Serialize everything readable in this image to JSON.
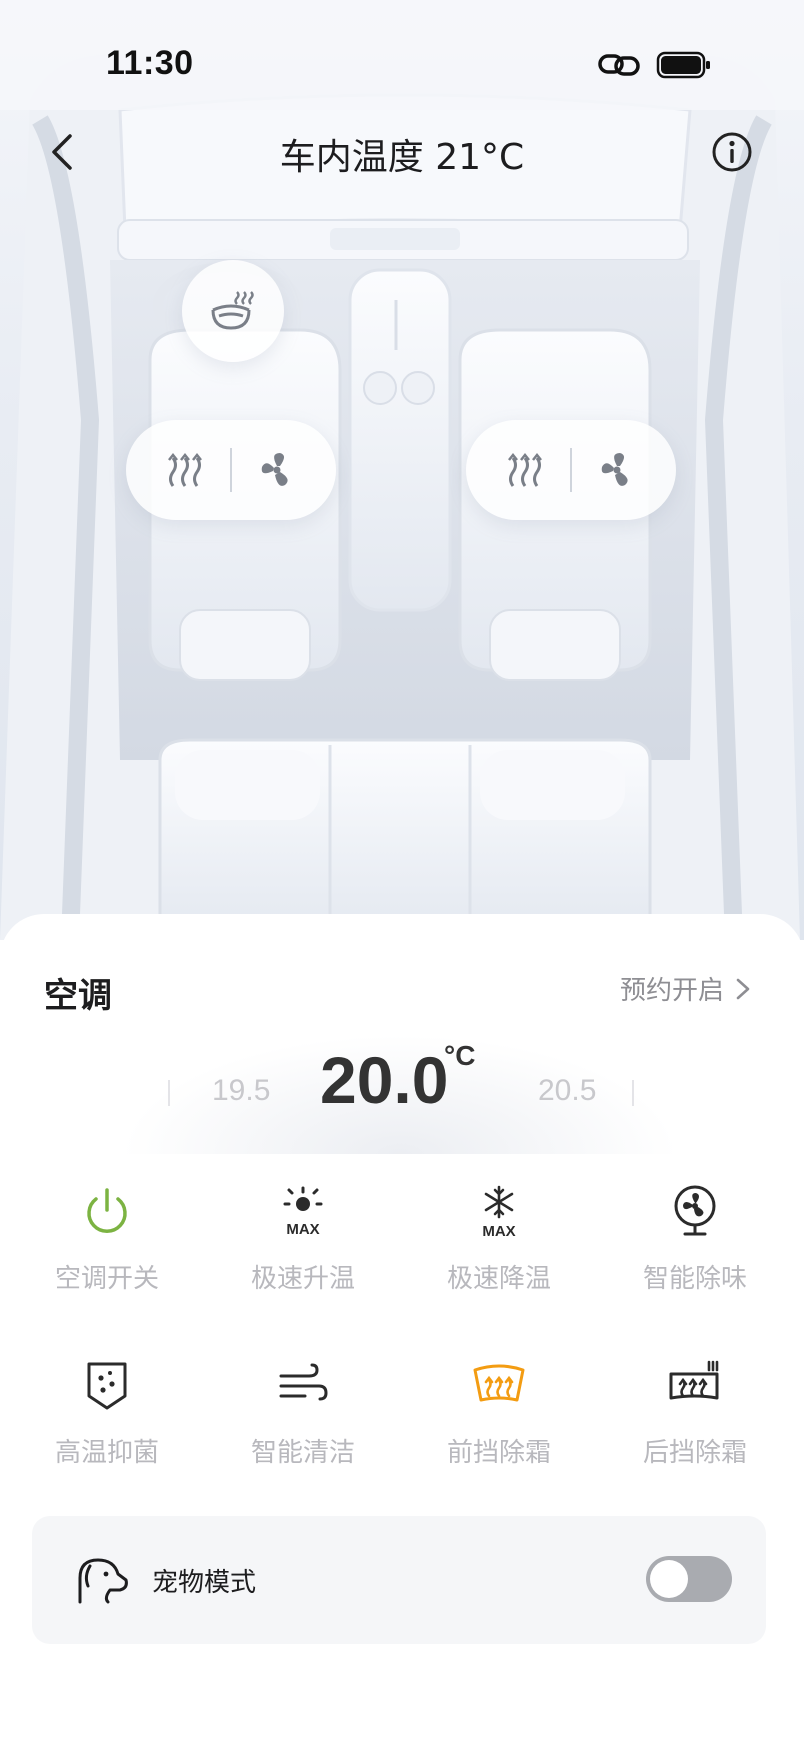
{
  "status_bar": {
    "time": "11:30"
  },
  "header": {
    "title": "车内温度 21°C"
  },
  "climate": {
    "section_title": "空调",
    "schedule_label": "预约开启",
    "temperature": {
      "current": "20.0",
      "unit": "°C",
      "prev": "19.5",
      "next": "20.5"
    }
  },
  "controls": [
    {
      "label": "空调开关",
      "icon": "power-icon",
      "color": "#7cb342"
    },
    {
      "label": "极速升温",
      "icon": "max-heat-icon",
      "color": "#2b2b2b"
    },
    {
      "label": "极速降温",
      "icon": "max-cool-icon",
      "color": "#2b2b2b"
    },
    {
      "label": "智能除味",
      "icon": "fan-deodorize-icon",
      "color": "#2b2b2b"
    },
    {
      "label": "高温抑菌",
      "icon": "sterilize-icon",
      "color": "#2b2b2b"
    },
    {
      "label": "智能清洁",
      "icon": "wind-clean-icon",
      "color": "#2b2b2b"
    },
    {
      "label": "前挡除霜",
      "icon": "front-defrost-icon",
      "color": "#f39c12"
    },
    {
      "label": "后挡除霜",
      "icon": "rear-defrost-icon",
      "color": "#2b2b2b"
    }
  ],
  "pet_mode": {
    "label": "宠物模式",
    "enabled": false
  },
  "colors": {
    "accent_green": "#7cb342",
    "accent_orange": "#f39c12",
    "label_gray": "#b8b8bd"
  }
}
